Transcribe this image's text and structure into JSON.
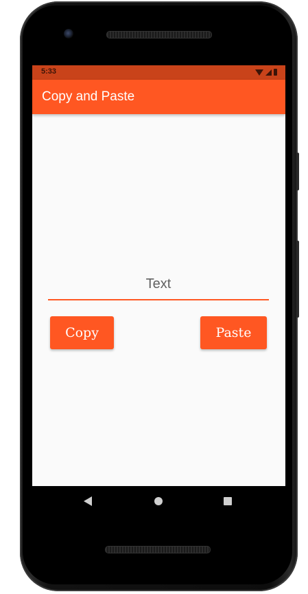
{
  "status_bar": {
    "time": "5:33",
    "icons": [
      "wifi-icon",
      "signal-icon",
      "battery-icon"
    ]
  },
  "app_bar": {
    "title": "Copy and Paste",
    "color": "#ff5722"
  },
  "main": {
    "text_field": {
      "placeholder": "Text",
      "value": ""
    },
    "copy_button": {
      "label": "Copy"
    },
    "paste_button": {
      "label": "Paste"
    }
  },
  "navigation_bar": {
    "icons": [
      "back-icon",
      "home-icon",
      "recents-icon"
    ]
  },
  "colors": {
    "accent": "#ff5722",
    "status_bar": "#c9431a",
    "background": "#fafafa"
  }
}
